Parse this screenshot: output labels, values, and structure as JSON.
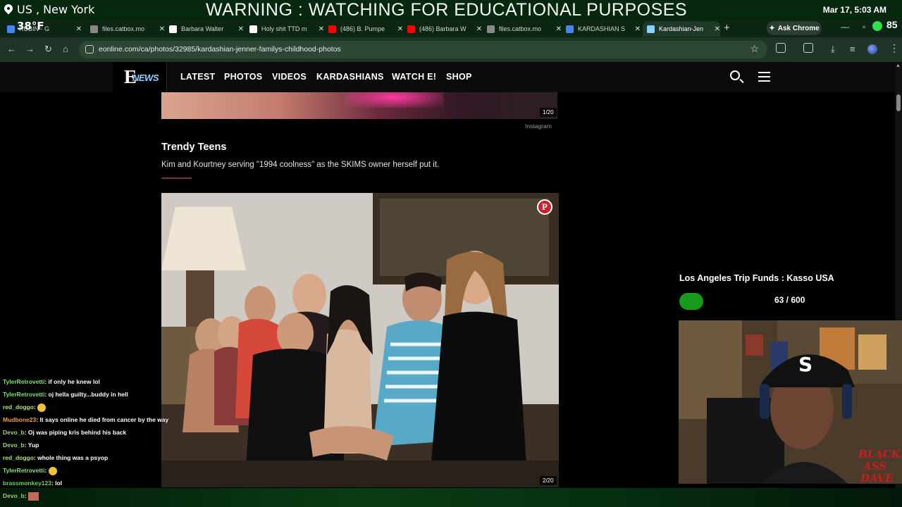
{
  "overlay": {
    "location": "US , New York",
    "temperature": "38°F",
    "warning": "WARNING : WATCHING FOR EDUCATIONAL PURPOSES",
    "datetime": "Mar 17, 5:03 AM",
    "side_number": "85"
  },
  "tabs": [
    {
      "title": "RUBIN - G",
      "icon": "google-icon",
      "color": "#4285f4"
    },
    {
      "title": "files.catbox.mo",
      "icon": "globe-icon",
      "color": "#888888"
    },
    {
      "title": "Barbara Walter",
      "icon": "wikipedia-icon",
      "color": "#ffffff"
    },
    {
      "title": "Holy shit TTD m",
      "icon": "s-icon",
      "color": "#ffffff"
    },
    {
      "title": "(486) B. Pumpe",
      "icon": "youtube-icon",
      "color": "#ff0000"
    },
    {
      "title": "(486) Barbara W",
      "icon": "youtube-icon",
      "color": "#ff0000"
    },
    {
      "title": "files.catbox.mo",
      "icon": "globe-icon",
      "color": "#888888"
    },
    {
      "title": "KARDASHIAN S",
      "icon": "google-icon",
      "color": "#4285f4"
    },
    {
      "title": "Kardashian-Jen",
      "icon": "enews-icon",
      "color": "#8ad1ff",
      "active": true
    }
  ],
  "browser": {
    "ask_chrome": "Ask Chrome",
    "url": "eonline.com/ca/photos/32985/kardashian-jenner-familys-childhood-photos"
  },
  "site": {
    "logo_e": "E",
    "logo_news": "NEWS",
    "nav": [
      "LATEST",
      "PHOTOS",
      "VIDEOS",
      "KARDASHIANS",
      "WATCH E!",
      "SHOP"
    ]
  },
  "article": {
    "prev_counter": "1/20",
    "prev_credit": "Instagram",
    "slide_title": "Trendy Teens",
    "slide_caption": "Kim and Kourtney serving \"1994 coolness\" as the SKIMS owner herself put it.",
    "counter": "2/20",
    "pinterest_icon": "P"
  },
  "sidebar": {
    "funds_title": "Los Angeles Trip Funds : Kasso USA",
    "funds_count": "63 / 600",
    "funds_progress": 0.105,
    "accent": "#159a1a"
  },
  "chat": [
    {
      "user": "TylerRetrovetti",
      "color": "#7ee36b",
      "text": ": if only he knew lol"
    },
    {
      "user": "TylerRetrovetti",
      "color": "#7ee36b",
      "text": ": oj hella guilty...buddy in hell"
    },
    {
      "user": "red_doggo",
      "color": "#a9e86a",
      "text": ": ",
      "emote": "emoji"
    },
    {
      "user": "Mudbone23",
      "color": "#f0a030",
      "text": ": It says online he died from cancer by the way"
    },
    {
      "user": "Devo_b",
      "color": "#9ad96b",
      "text": ": Oj was piping kris behind his back"
    },
    {
      "user": "Devo_b",
      "color": "#9ad96b",
      "text": ": Yup"
    },
    {
      "user": "red_doggo",
      "color": "#a9e86a",
      "text": ": whole thing was a psyop"
    },
    {
      "user": "TylerRetrovetti",
      "color": "#7ee36b",
      "text": ": ",
      "emote": "emoji"
    },
    {
      "user": "brassmonkey123",
      "color": "#5fdc5f",
      "text": ": lol"
    },
    {
      "user": "Devo_b",
      "color": "#9ad96b",
      "text": ": ",
      "emote": "image"
    }
  ],
  "webcam": {
    "cap_letter": "S",
    "watermark_1": "BLACK",
    "watermark_2": "ASS",
    "watermark_3": "DAVE"
  }
}
